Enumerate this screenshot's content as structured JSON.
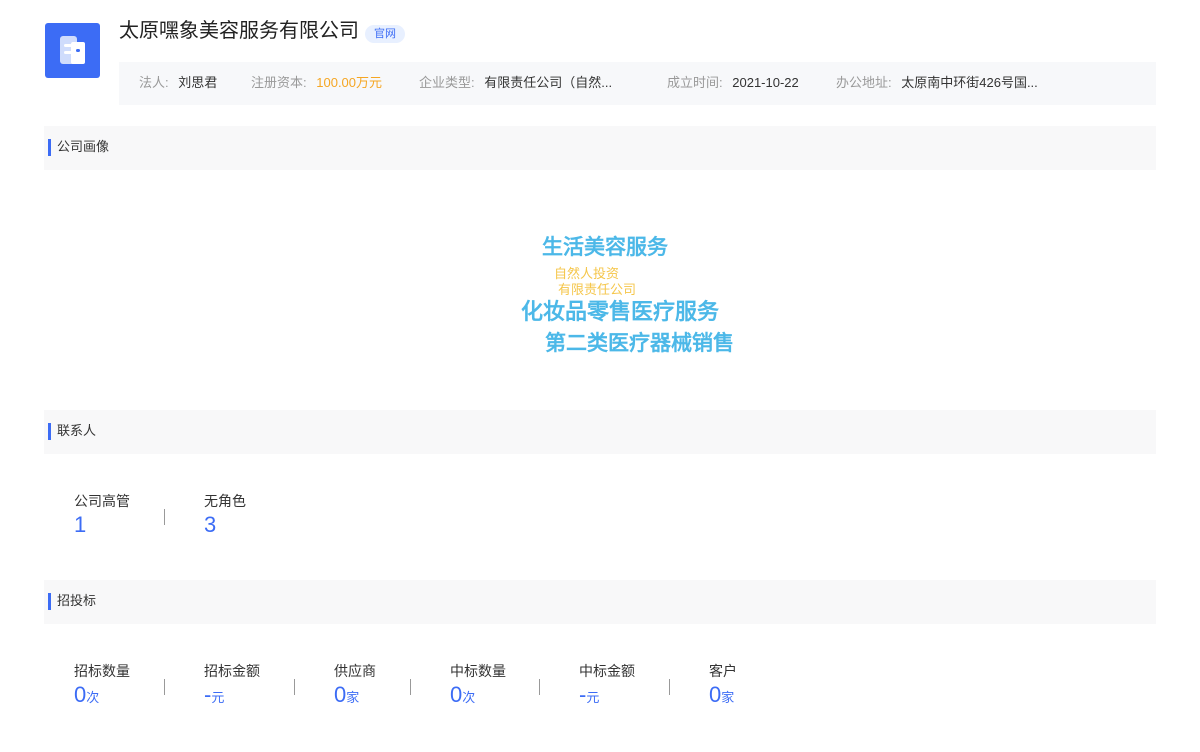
{
  "header": {
    "company_name": "太原嘿象美容服务有限公司",
    "badge": "官网",
    "info": [
      {
        "label": "法人:",
        "value": "刘思君"
      },
      {
        "label": "注册资本:",
        "value": "100.00万元"
      },
      {
        "label": "企业类型:",
        "value": "有限责任公司（自然..."
      },
      {
        "label": "成立时间:",
        "value": "2021-10-22"
      },
      {
        "label": "办公地址:",
        "value": "太原南中环街426号国..."
      }
    ]
  },
  "portrait": {
    "title": "公司画像",
    "words": [
      {
        "text": "生活美容服务",
        "color": "#4cb8e8"
      },
      {
        "text": "自然人投资",
        "color": "#f5c64a"
      },
      {
        "text": "有限责任公司",
        "color": "#f5c64a"
      },
      {
        "text": "化妆品零售医疗服务",
        "color": "#4cb8e8"
      },
      {
        "text": "第二类医疗器械销售",
        "color": "#4cb8e8"
      }
    ]
  },
  "contacts": {
    "title": "联系人",
    "stats": [
      {
        "label": "公司高管",
        "value": "1",
        "unit": ""
      },
      {
        "label": "无角色",
        "value": "3",
        "unit": ""
      }
    ]
  },
  "bidding": {
    "title": "招投标",
    "stats": [
      {
        "label": "招标数量",
        "value": "0",
        "unit": "次"
      },
      {
        "label": "招标金额",
        "value": "-",
        "unit": "元"
      },
      {
        "label": "供应商",
        "value": "0",
        "unit": "家"
      },
      {
        "label": "中标数量",
        "value": "0",
        "unit": "次"
      },
      {
        "label": "中标金额",
        "value": "-",
        "unit": "元"
      },
      {
        "label": "客户",
        "value": "0",
        "unit": "家"
      }
    ]
  },
  "colors": {
    "accent": "#3c6cf5",
    "capital": "#f5a623"
  }
}
